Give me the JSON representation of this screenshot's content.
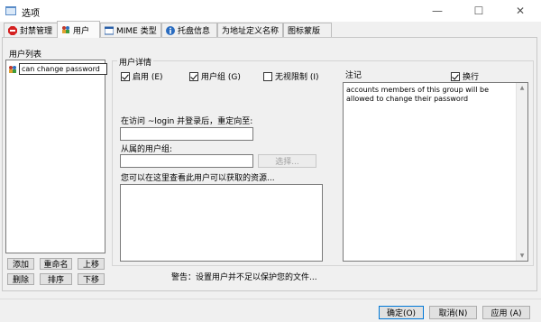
{
  "window": {
    "title": "选项",
    "controls": {
      "minimize": "—",
      "maximize": "☐",
      "close": "✕"
    }
  },
  "tabs": [
    {
      "label": "封禁管理"
    },
    {
      "label": "用户"
    },
    {
      "label": "MIME 类型"
    },
    {
      "label": "托盘信息"
    },
    {
      "label": "为地址定义名称"
    },
    {
      "label": "图标蒙版"
    }
  ],
  "user_list": {
    "title": "用户列表",
    "items": [
      {
        "label": "can change password",
        "selected": true
      }
    ],
    "buttons": {
      "add": "添加",
      "rename": "重命名",
      "move_up": "上移",
      "delete": "删除",
      "sort": "排序",
      "move_down": "下移"
    }
  },
  "details": {
    "group_title": "用户详情",
    "enable_label": "启用 (E)",
    "enable_checked": true,
    "group_label": "用户组 (G)",
    "group_checked": true,
    "unlimited_label": "无视限制 (I)",
    "unlimited_checked": false,
    "redirect_label": "在访问 ~login 并登录后，重定向至:",
    "redirect_value": "",
    "belongs_label": "从属的用户组:",
    "belongs_value": "",
    "select_button": "选择...",
    "resources_label": "您可以在这里查看此用户可以获取的资源..."
  },
  "notes": {
    "label": "注记",
    "wrap_label": "换行",
    "wrap_checked": true,
    "text": "accounts members of this group will be allowed to change their password"
  },
  "warning": "警告：设置用户并不足以保护您的文件...",
  "footer": {
    "ok": "确定(O)",
    "cancel": "取消(N)",
    "apply": "应用 (A)"
  },
  "colors": {
    "accent": "#0078d7",
    "stop_icon": "#d42020"
  }
}
